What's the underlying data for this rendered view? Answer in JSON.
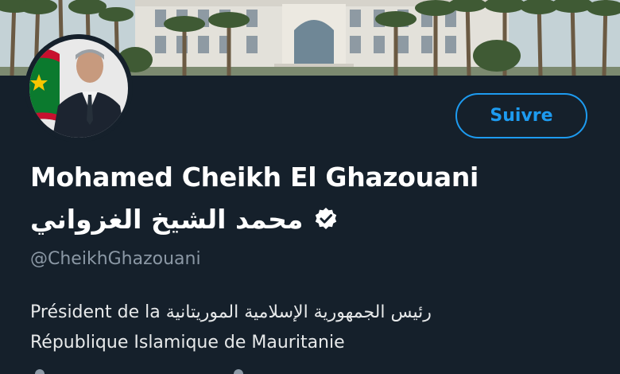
{
  "profile": {
    "name": "Mohamed Cheikh El Ghazouani",
    "name_arabic": "محمد الشيخ الغزواني",
    "handle": "@CheikhGhazouani",
    "verified": true,
    "follow_label": "Suivre",
    "bio_line1": "Président de la رئيس الجمهورية الإسلامية الموريتانية",
    "bio_line2": "République Islamique de Mauritanie"
  },
  "icons": {
    "verified": "verified-badge-icon",
    "flag": "mauritania-flag"
  },
  "colors": {
    "background": "#15202b",
    "accent": "#1d9bf0",
    "handle": "#8b98a5",
    "text": "#ffffff"
  }
}
